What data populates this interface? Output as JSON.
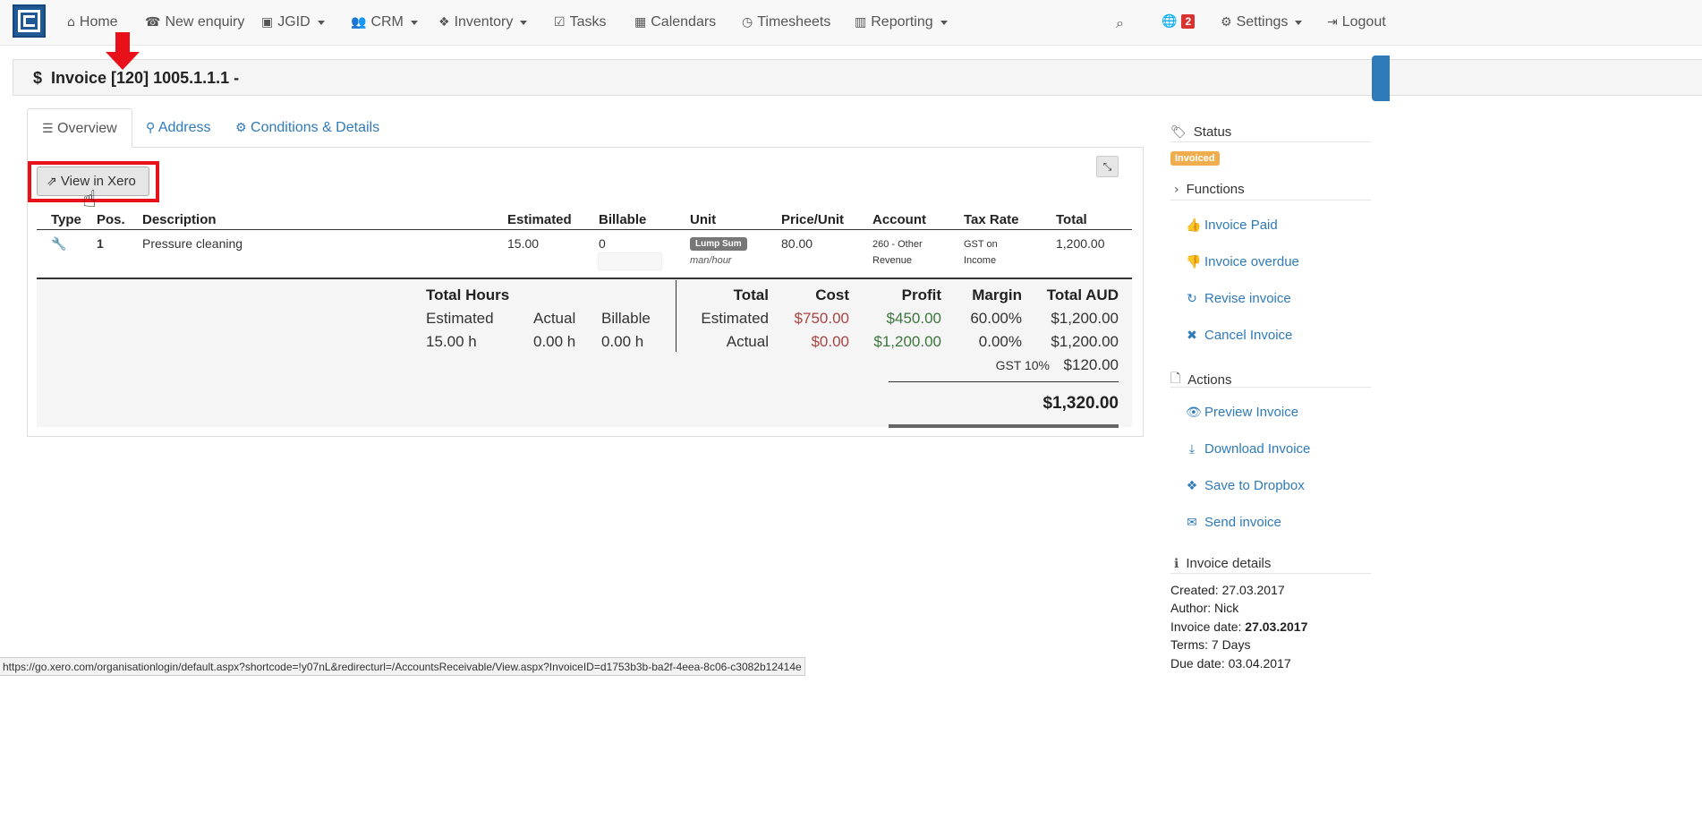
{
  "nav": {
    "home": "Home",
    "new_enquiry": "New enquiry",
    "jgid": "JGID",
    "crm": "CRM",
    "inventory": "Inventory",
    "tasks": "Tasks",
    "calendars": "Calendars",
    "timesheets": "Timesheets",
    "reporting": "Reporting",
    "notif_count": "2",
    "settings": "Settings",
    "logout": "Logout"
  },
  "page": {
    "title": "Invoice [120] 1005.1.1.1 -"
  },
  "tabs": [
    {
      "label": "Overview"
    },
    {
      "label": "Address"
    },
    {
      "label": "Conditions & Details"
    }
  ],
  "view_xero_label": "View in Xero",
  "table": {
    "headers": {
      "type": "Type",
      "pos": "Pos.",
      "description": "Description",
      "estimated": "Estimated",
      "billable": "Billable",
      "unit": "Unit",
      "price_unit": "Price/Unit",
      "account": "Account",
      "tax_rate": "Tax Rate",
      "total": "Total"
    },
    "row": {
      "pos": "1",
      "description": "Pressure cleaning",
      "estimated": "15.00",
      "billable": "0",
      "unit_badge": "Lump Sum",
      "unit_sub": "man/hour",
      "price": "80.00",
      "account": "260 - Other Revenue",
      "tax_rate": "GST on Income",
      "total": "1,200.00"
    }
  },
  "summary": {
    "total_hours": "Total Hours",
    "estimated": "Estimated",
    "actual": "Actual",
    "billable": "Billable",
    "est_hours": "15.00 h",
    "act_hours": "0.00 h",
    "bill_hours": "0.00 h",
    "col_total": "Total",
    "col_cost": "Cost",
    "col_profit": "Profit",
    "col_margin": "Margin",
    "col_total_aud": "Total AUD",
    "row_est": "Estimated",
    "row_act": "Actual",
    "est_cost": "$750.00",
    "est_profit": "$450.00",
    "est_margin": "60.00%",
    "est_total": "$1,200.00",
    "act_cost": "$0.00",
    "act_profit": "$1,200.00",
    "act_margin": "0.00%",
    "act_total": "$1,200.00",
    "gst_label": "GST 10%",
    "gst_value": "$120.00",
    "grand_total": "$1,320.00"
  },
  "sidebar": {
    "status_head": "Status",
    "status_badge": "Invoiced",
    "functions_head": "Functions",
    "invoice_paid": "Invoice Paid",
    "invoice_overdue": "Invoice overdue",
    "revise_invoice": "Revise invoice",
    "cancel_invoice": "Cancel Invoice",
    "actions_head": "Actions",
    "preview_invoice": "Preview Invoice",
    "download_invoice": "Download Invoice",
    "save_dropbox": "Save to Dropbox",
    "send_invoice": "Send invoice",
    "details_head": "Invoice details",
    "created": "Created: 27.03.2017",
    "author": "Author: Nick",
    "invoice_date_label": "Invoice date: ",
    "invoice_date": "27.03.2017",
    "terms": "Terms: 7 Days",
    "due_date": "Due date: 03.04.2017"
  },
  "status_url": "https://go.xero.com/organisationlogin/default.aspx?shortcode=!y07nL&redirecturl=/AccountsReceivable/View.aspx?InvoiceID=d1753b3b-ba2f-4eea-8c06-c3082b12414e",
  "colors": {
    "link": "#2f7ab9",
    "accent": "#e8111a",
    "badge": "#f0ad4e"
  }
}
